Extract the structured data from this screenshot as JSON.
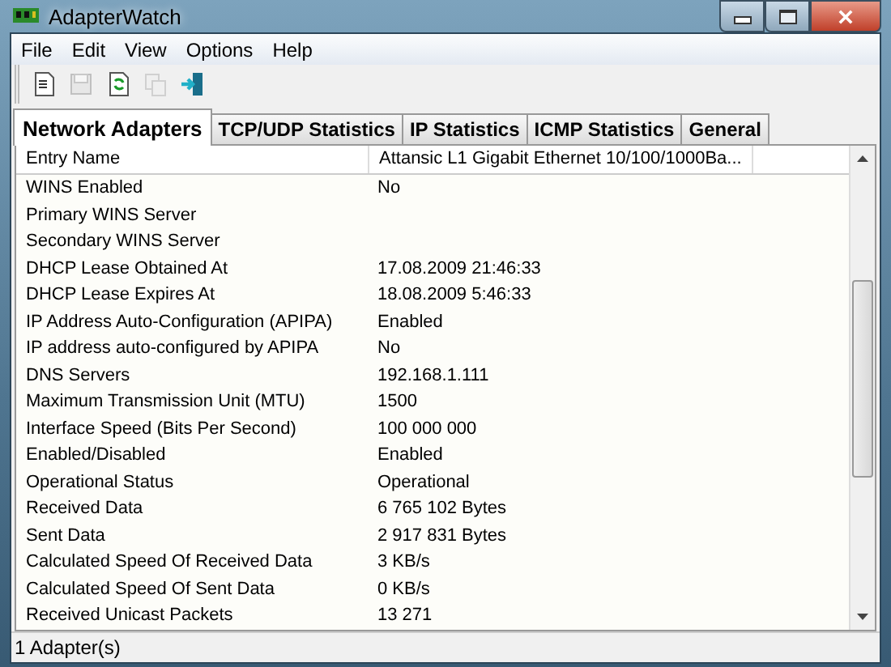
{
  "window": {
    "title": "AdapterWatch"
  },
  "menu": [
    "File",
    "Edit",
    "View",
    "Options",
    "Help"
  ],
  "toolbar": [
    {
      "kind": "report",
      "disabled": false
    },
    {
      "kind": "save",
      "disabled": true
    },
    {
      "kind": "refresh",
      "disabled": false
    },
    {
      "kind": "copy",
      "disabled": true
    },
    {
      "kind": "exit",
      "disabled": false
    }
  ],
  "tabs": [
    {
      "label": "Network Adapters",
      "selected": true
    },
    {
      "label": "TCP/UDP Statistics",
      "selected": false
    },
    {
      "label": "IP Statistics",
      "selected": false
    },
    {
      "label": "ICMP Statistics",
      "selected": false
    },
    {
      "label": "General",
      "selected": false
    }
  ],
  "table": {
    "columns": [
      "Entry Name",
      "Attansic L1 Gigabit Ethernet 10/100/1000Ba..."
    ],
    "rows": [
      [
        "WINS Enabled",
        "No"
      ],
      [
        "Primary WINS Server",
        ""
      ],
      [
        "Secondary  WINS Server",
        ""
      ],
      [
        "DHCP Lease Obtained At",
        "17.08.2009 21:46:33"
      ],
      [
        "DHCP Lease Expires At",
        "18.08.2009 5:46:33"
      ],
      [
        "IP Address Auto-Configuration (APIPA)",
        "Enabled"
      ],
      [
        "IP address auto-configured by APIPA",
        "No"
      ],
      [
        "DNS Servers",
        "192.168.1.111"
      ],
      [
        "Maximum Transmission Unit (MTU)",
        "1500"
      ],
      [
        "Interface Speed (Bits Per Second)",
        "100 000 000"
      ],
      [
        "Enabled/Disabled",
        "Enabled"
      ],
      [
        "Operational Status",
        "Operational"
      ],
      [
        "Received Data",
        "6 765 102 Bytes"
      ],
      [
        "Sent Data",
        "2 917 831 Bytes"
      ],
      [
        "Calculated Speed Of Received Data",
        "3 KB/s"
      ],
      [
        "Calculated Speed Of Sent Data",
        "0 KB/s"
      ],
      [
        "Received Unicast Packets",
        "13 271"
      ]
    ]
  },
  "status_bar": "1 Adapter(s)"
}
